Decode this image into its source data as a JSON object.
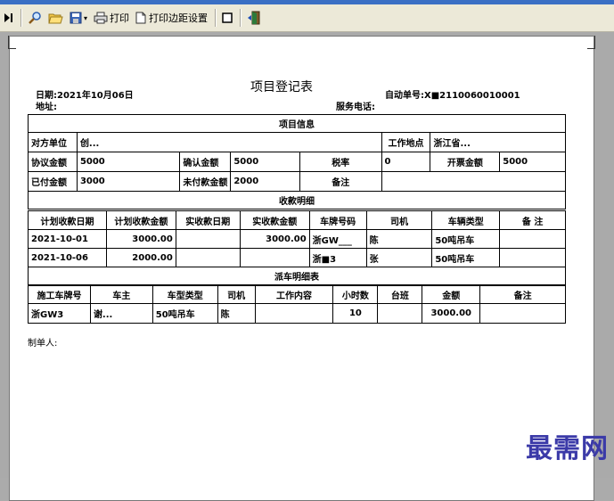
{
  "toolbar": {
    "print_label": "打印",
    "page_setup_label": "打印边距设置"
  },
  "report": {
    "title": "项目登记表",
    "date_label": "日期:2021年10月06日",
    "address_label": "地址:",
    "auto_no_label": "自动单号:",
    "auto_no_value": "X■2110060010001",
    "service_phone_label": "服务电话:",
    "maker_label": "制单人:",
    "project_section": "项目信息",
    "fields": {
      "counterparty_label": "对方单位",
      "counterparty_value": "创...",
      "work_place_label": "工作地点",
      "work_place_value": "浙江省...",
      "agreed_label": "协议金额",
      "agreed_value": "5000",
      "confirmed_label": "确认金额",
      "confirmed_value": "5000",
      "tax_label": "税率",
      "tax_value": "0",
      "invoice_label": "开票金额",
      "invoice_value": "5000",
      "paid_label": "已付金额",
      "paid_value": "3000",
      "unpaid_label": "未付款金额",
      "unpaid_value": "2000",
      "remark_label": "备注",
      "remark_value": ""
    },
    "receipts": {
      "title": "收款明细",
      "headers": [
        "计划收款日期",
        "计划收款金额",
        "实收款日期",
        "实收款金额",
        "车牌号码",
        "司机",
        "车辆类型",
        "备 注"
      ],
      "rows": [
        [
          "2021-10-01",
          "3000.00",
          "",
          "3000.00",
          "浙GW___",
          "陈",
          "50吨吊车",
          ""
        ],
        [
          "2021-10-06",
          "2000.00",
          "",
          "",
          "浙■3",
          "张",
          "50吨吊车",
          ""
        ]
      ]
    },
    "dispatch": {
      "title": "派车明细表",
      "headers": [
        "施工车牌号",
        "车主",
        "车型类型",
        "司机",
        "工作内容",
        "小时数",
        "台班",
        "金额",
        "备注"
      ],
      "rows": [
        [
          "浙GW3",
          "谢...",
          "50吨吊车",
          "陈",
          "",
          "10",
          "",
          "3000.00",
          ""
        ]
      ]
    }
  },
  "watermark": "最需网",
  "colors": {
    "titlebar": "#3a6fc4",
    "toolbar_bg": "#ece9d8",
    "watermark": "#3b3aa8"
  }
}
